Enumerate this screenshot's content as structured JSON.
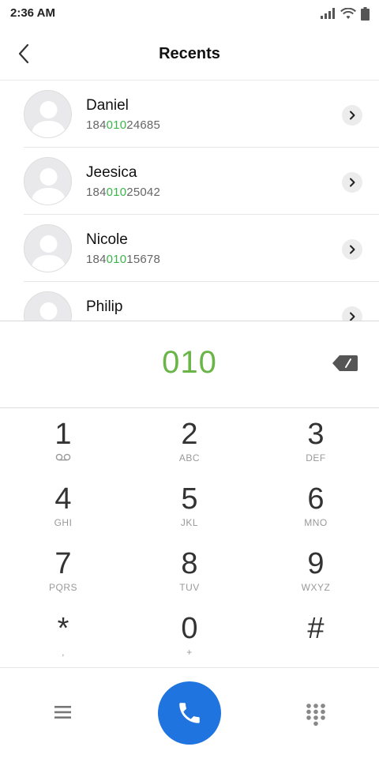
{
  "status_bar": {
    "time": "2:36 AM",
    "icons": [
      "signal-icon",
      "wifi-icon",
      "battery-icon"
    ]
  },
  "header": {
    "title": "Recents",
    "back_icon": "back-arrow-icon"
  },
  "recents": [
    {
      "name": "Daniel",
      "number_prefix": "184",
      "number_match": "010",
      "number_suffix": "24685"
    },
    {
      "name": "Jeesica",
      "number_prefix": "184",
      "number_match": "010",
      "number_suffix": "25042"
    },
    {
      "name": "Nicole",
      "number_prefix": "184",
      "number_match": "010",
      "number_suffix": "15678"
    },
    {
      "name": "Philip",
      "number_prefix": "",
      "number_match": "",
      "number_suffix": ""
    }
  ],
  "dialer": {
    "dialed_number": "010",
    "backspace_icon": "backspace-icon"
  },
  "keypad": {
    "keys": [
      {
        "digit": "1",
        "letters": ""
      },
      {
        "digit": "2",
        "letters": "ABC"
      },
      {
        "digit": "3",
        "letters": "DEF"
      },
      {
        "digit": "4",
        "letters": "GHI"
      },
      {
        "digit": "5",
        "letters": "JKL"
      },
      {
        "digit": "6",
        "letters": "MNO"
      },
      {
        "digit": "7",
        "letters": "PQRS"
      },
      {
        "digit": "8",
        "letters": "TUV"
      },
      {
        "digit": "9",
        "letters": "WXYZ"
      },
      {
        "digit": "*",
        "letters": ","
      },
      {
        "digit": "0",
        "letters": "+"
      },
      {
        "digit": "#",
        "letters": ""
      }
    ]
  },
  "bottom_bar": {
    "menu_icon": "menu-icon",
    "call_icon": "phone-icon",
    "keypad_icon": "dialpad-icon"
  },
  "colors": {
    "match_highlight": "#3ab54a",
    "dialed_number": "#6ab547",
    "call_button": "#1f74e0"
  }
}
